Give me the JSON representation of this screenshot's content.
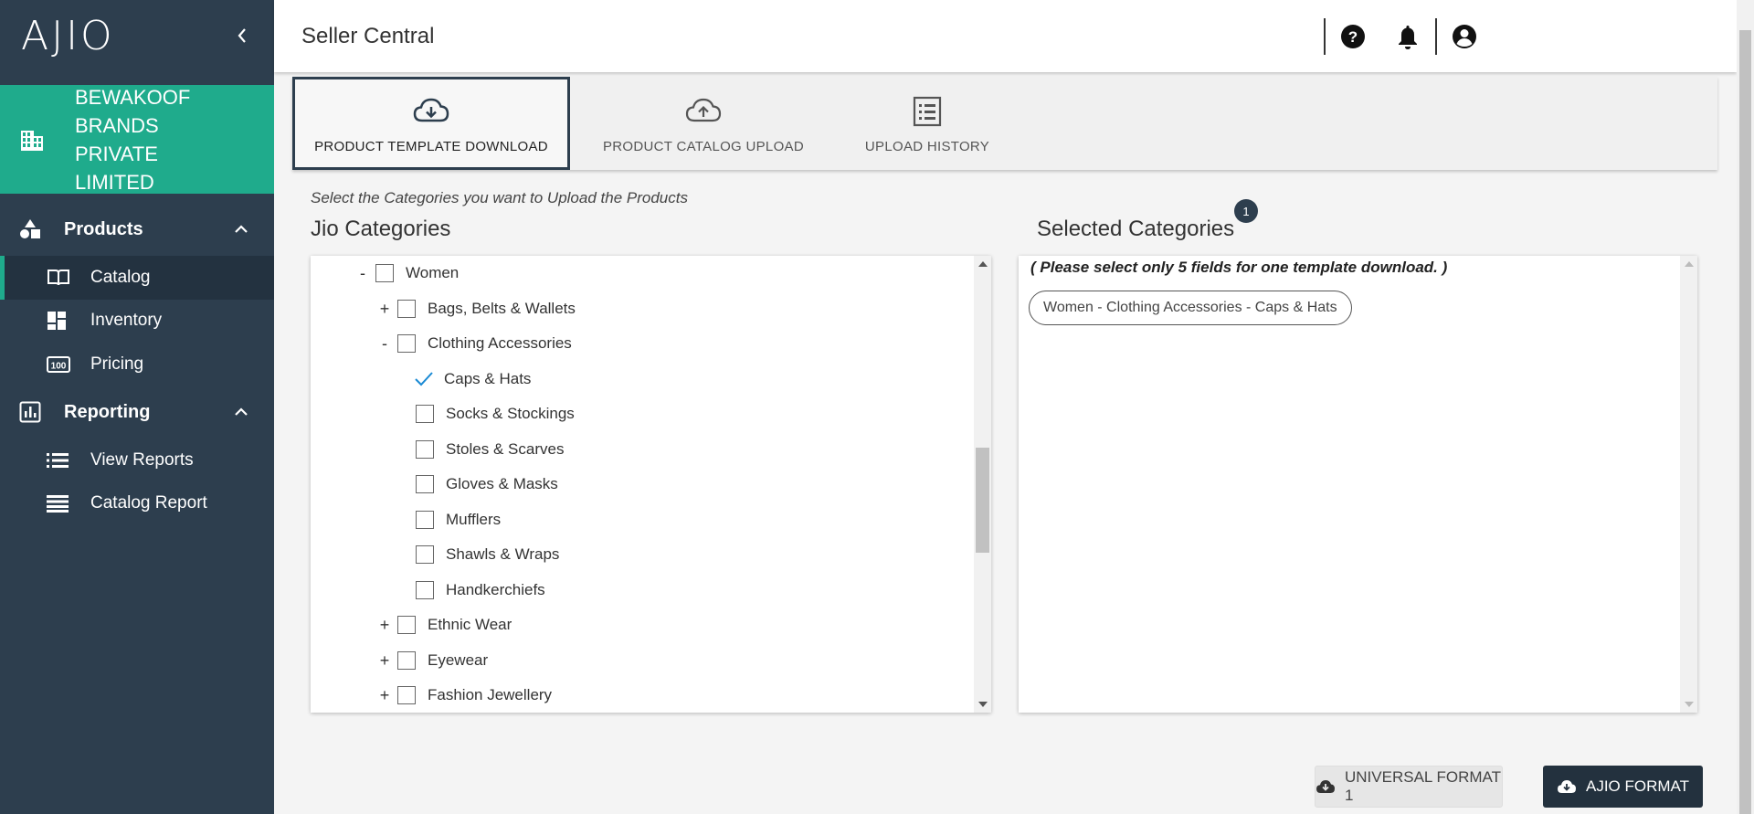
{
  "brand": {
    "logo": "AJIO"
  },
  "seller": {
    "name": "BEWAKOOF BRANDS PRIVATE LIMITED"
  },
  "sidebar": {
    "sections": [
      {
        "label": "Products",
        "icon": "shapes-icon"
      },
      {
        "label": "Reporting",
        "icon": "bar-chart-icon"
      }
    ],
    "items": [
      {
        "label": "Catalog",
        "icon": "book-open-icon",
        "active": true
      },
      {
        "label": "Inventory",
        "icon": "dashboard-icon"
      },
      {
        "label": "Pricing",
        "icon": "price-tag-icon"
      },
      {
        "label": "View Reports",
        "icon": "list-icon"
      },
      {
        "label": "Catalog Report",
        "icon": "lines-icon"
      }
    ]
  },
  "header": {
    "title": "Seller Central",
    "actions": [
      "help-icon",
      "bell-icon",
      "account-icon"
    ]
  },
  "tabs": [
    {
      "label": "PRODUCT TEMPLATE DOWNLOAD",
      "icon": "cloud-download-icon",
      "active": true
    },
    {
      "label": "PRODUCT CATALOG UPLOAD",
      "icon": "cloud-upload-icon"
    },
    {
      "label": "UPLOAD HISTORY",
      "icon": "history-list-icon"
    }
  ],
  "instruction": "Select the Categories you want to Upload the Products",
  "jio_categories": {
    "title": "Jio Categories",
    "rows": [
      {
        "toggle": "-",
        "label": "Women",
        "checked": false
      },
      {
        "toggle": "+",
        "label": "Bags, Belts & Wallets",
        "checked": false
      },
      {
        "toggle": "-",
        "label": "Clothing Accessories",
        "checked": false
      },
      {
        "toggle": "",
        "label": "Caps & Hats",
        "checked": true
      },
      {
        "toggle": "",
        "label": "Socks & Stockings",
        "checked": false
      },
      {
        "toggle": "",
        "label": "Stoles & Scarves",
        "checked": false
      },
      {
        "toggle": "",
        "label": "Gloves & Masks",
        "checked": false
      },
      {
        "toggle": "",
        "label": "Mufflers",
        "checked": false
      },
      {
        "toggle": "",
        "label": "Shawls & Wraps",
        "checked": false
      },
      {
        "toggle": "",
        "label": "Handkerchiefs",
        "checked": false
      },
      {
        "toggle": "+",
        "label": "Ethnic Wear",
        "checked": false
      },
      {
        "toggle": "+",
        "label": "Eyewear",
        "checked": false
      },
      {
        "toggle": "+",
        "label": "Fashion Jewellery",
        "checked": false
      }
    ]
  },
  "selected_categories": {
    "title": "Selected Categories",
    "count": "1",
    "note": "( Please select only 5 fields for one template download. )",
    "chips": [
      "Women - Clothing Accessories - Caps & Hats"
    ]
  },
  "buttons": {
    "universal": "UNIVERSAL FORMAT 1",
    "ajio": "AJIO FORMAT"
  },
  "colors": {
    "sidebar_bg": "#2d3e4e",
    "accent": "#1fab8c",
    "check": "#1a8ad4"
  }
}
